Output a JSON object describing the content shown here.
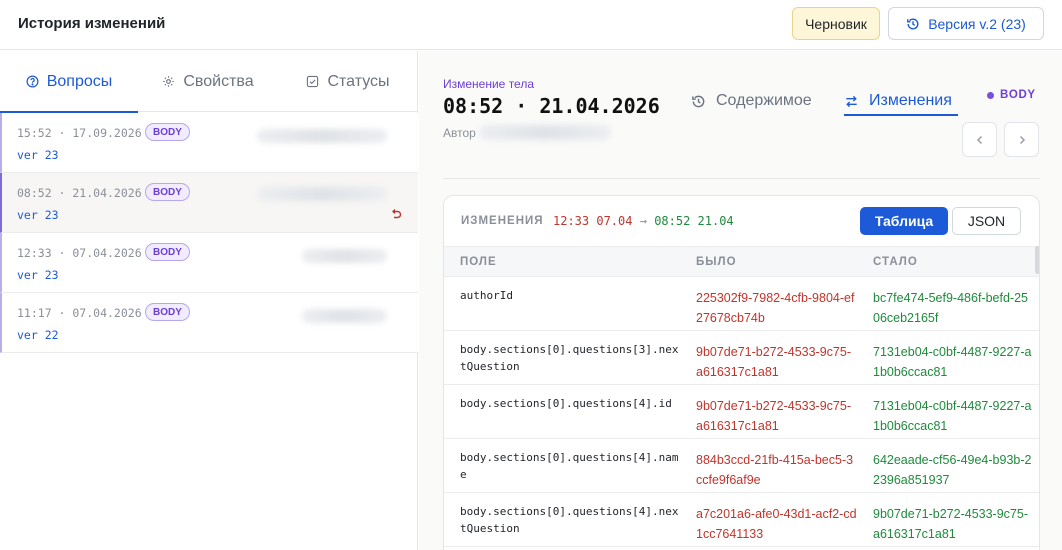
{
  "header": {
    "title": "История изменений",
    "draft_label": "Черновик",
    "version_label": "Версия v.2 (23)"
  },
  "left_tabs": [
    {
      "label": "Вопросы",
      "icon": "question-circle-icon",
      "active": true
    },
    {
      "label": "Свойства",
      "icon": "gear-icon",
      "active": false
    },
    {
      "label": "Статусы",
      "icon": "checkbox-icon",
      "active": false
    }
  ],
  "history": [
    {
      "timestamp": "15:52 · 17.09.2026",
      "badge": "BODY",
      "version": "ver 23",
      "selected": false,
      "revert": false
    },
    {
      "timestamp": "08:52 · 21.04.2026",
      "badge": "BODY",
      "version": "ver 23",
      "selected": true,
      "revert": true
    },
    {
      "timestamp": "12:33 · 07.04.2026",
      "badge": "BODY",
      "version": "ver 23",
      "selected": false,
      "revert": false
    },
    {
      "timestamp": "11:17 · 07.04.2026",
      "badge": "BODY",
      "version": "ver 22",
      "selected": false,
      "revert": false
    }
  ],
  "detail": {
    "change_label": "Изменение тела",
    "change_time": "08:52 · 21.04.2026",
    "author_label": "Автор",
    "view_tabs": [
      {
        "label": "Содержимое",
        "icon": "history-icon",
        "active": false
      },
      {
        "label": "Изменения",
        "icon": "swap-arrows-icon",
        "active": true
      }
    ],
    "scope_badge": "BODY",
    "prev_icon": "chevron-left-icon",
    "next_icon": "chevron-right-icon"
  },
  "changes": {
    "caption": "ИЗМЕНЕНИЯ",
    "range_from": "12:33 07.04",
    "range_arrow": "→",
    "range_to": "08:52 21.04",
    "view_table_label": "Таблица",
    "view_json_label": "JSON",
    "columns": [
      "ПОЛЕ",
      "БЫЛО",
      "СТАЛО"
    ],
    "rows": [
      {
        "field": "authorId",
        "old": "225302f9-7982-4cfb-9804-ef27678cb74b",
        "new": "bc7fe474-5ef9-486f-befd-2506ceb2165f"
      },
      {
        "field": "body.sections[0].questions[3].nextQuestion",
        "old": "9b07de71-b272-4533-9c75-a616317c1a81",
        "new": "7131eb04-c0bf-4487-9227-a1b0b6ccac81"
      },
      {
        "field": "body.sections[0].questions[4].id",
        "old": "9b07de71-b272-4533-9c75-a616317c1a81",
        "new": "7131eb04-c0bf-4487-9227-a1b0b6ccac81"
      },
      {
        "field": "body.sections[0].questions[4].name",
        "old": "884b3ccd-21fb-415a-bec5-3ccfe9f6af9e",
        "new": "642eaade-cf56-49e4-b93b-22396a851937"
      },
      {
        "field": "body.sections[0].questions[4].nextQuestion",
        "old": "a7c201a6-afe0-43d1-acf2-cd1cc7641133",
        "new": "9b07de71-b272-4533-9c75-a616317c1a81"
      }
    ]
  },
  "colors": {
    "accent": "#1d5ad8",
    "purple": "#6d3fd6",
    "old_value": "#c0342b",
    "new_value": "#1f8a3c",
    "draft_bg": "#fdf6d8"
  }
}
